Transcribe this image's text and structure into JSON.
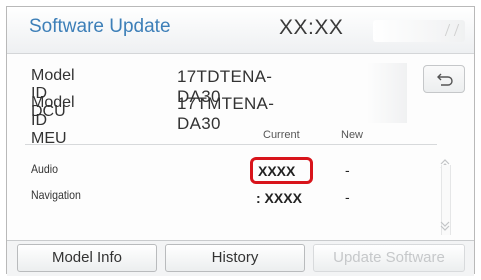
{
  "header": {
    "title": "Software Update",
    "clock": "XX:XX"
  },
  "info": {
    "rows": [
      {
        "label": "Model ID DCU",
        "value": "17TDTENA-DA30"
      },
      {
        "label": "Model ID MEU",
        "value": "17TMTENA-DA30"
      }
    ],
    "back_icon": "back-arrow-icon"
  },
  "table": {
    "columns": [
      "Current",
      "New"
    ],
    "rows": [
      {
        "label": "Audio",
        "current": "XXXX",
        "new": "-",
        "highlighted": true
      },
      {
        "label": "Navigation",
        "current": ": XXXX",
        "new": "-",
        "highlighted": false
      }
    ],
    "highlight_color": "#d8141b"
  },
  "scroll": {
    "up_icon": "double-chevron-up-icon",
    "down_icon": "double-chevron-down-icon"
  },
  "footer": {
    "buttons": [
      {
        "label": "Model Info",
        "enabled": true
      },
      {
        "label": "History",
        "enabled": true
      },
      {
        "label": "Update Software",
        "enabled": false
      }
    ]
  },
  "colors": {
    "title": "#3d7fb8",
    "text": "#333333",
    "disabled": "#c6c8ca"
  }
}
